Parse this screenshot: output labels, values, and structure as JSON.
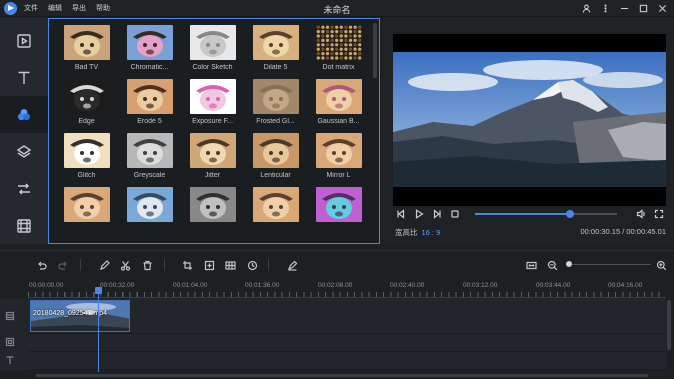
{
  "app": {
    "title": "未命名",
    "menu": [
      "文件",
      "编辑",
      "导出",
      "帮助"
    ]
  },
  "rail": {
    "items": [
      "media-icon",
      "text-icon",
      "filters-icon",
      "overlays-icon",
      "transitions-icon",
      "elements-icon"
    ],
    "active": "filters-icon"
  },
  "effects": {
    "items": [
      {
        "label": "Bad TV"
      },
      {
        "label": "Chromatic..."
      },
      {
        "label": "Color Sketch"
      },
      {
        "label": "Dilate 5"
      },
      {
        "label": "Dot matrix"
      },
      {
        "label": "Edge"
      },
      {
        "label": "Erode 5"
      },
      {
        "label": "Exposure F..."
      },
      {
        "label": "Frosted Gl..."
      },
      {
        "label": "Gaussian B..."
      },
      {
        "label": "Glitch"
      },
      {
        "label": "Greyscale"
      },
      {
        "label": "Jitter"
      },
      {
        "label": "Lenticular"
      },
      {
        "label": "Mirror L"
      },
      {
        "label": ""
      },
      {
        "label": ""
      },
      {
        "label": ""
      },
      {
        "label": ""
      },
      {
        "label": ""
      }
    ]
  },
  "preview": {
    "aspect_label": "宽高比",
    "aspect_value": "16 : 9",
    "timecode": "00:00:30.15 / 00:00:45.01",
    "progress": 0.67
  },
  "timeline": {
    "ruler": [
      "00:00:00.00",
      "00:00:32.00",
      "00:01:04.00",
      "00:01:36.00",
      "00:02:08.00",
      "00:02:40.00",
      "00:03:12.00",
      "00:03:44.00",
      "00:04:16.00"
    ],
    "clip_label": "20180428_092547.mp4",
    "zoom_level": 0.0
  },
  "colors": {
    "accent": "#4a86e8",
    "background": "#1d2023",
    "panel": "#1b1e21"
  }
}
